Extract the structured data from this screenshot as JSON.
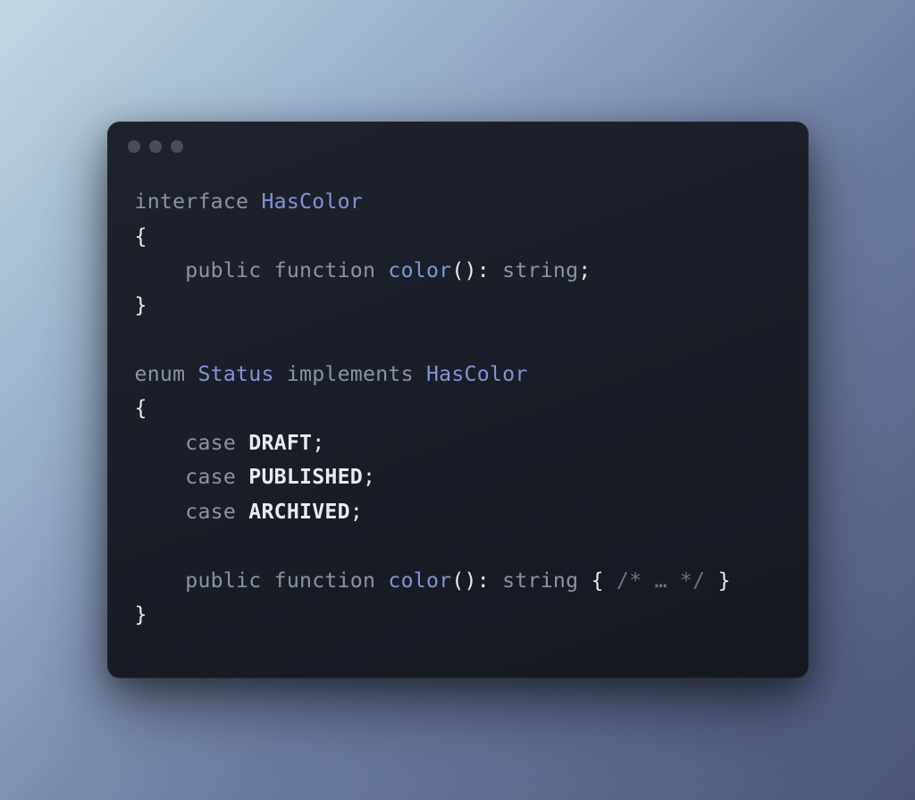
{
  "code": {
    "lines": [
      {
        "segments": [
          {
            "cls": "kw",
            "t": "interface"
          },
          {
            "cls": "",
            "t": " "
          },
          {
            "cls": "type",
            "t": "HasColor"
          }
        ]
      },
      {
        "segments": [
          {
            "cls": "brace",
            "t": "{"
          }
        ]
      },
      {
        "segments": [
          {
            "cls": "",
            "t": "    "
          },
          {
            "cls": "kw",
            "t": "public"
          },
          {
            "cls": "",
            "t": " "
          },
          {
            "cls": "kw",
            "t": "function"
          },
          {
            "cls": "",
            "t": " "
          },
          {
            "cls": "fn",
            "t": "color"
          },
          {
            "cls": "punct",
            "t": "():"
          },
          {
            "cls": "",
            "t": " "
          },
          {
            "cls": "retkw",
            "t": "string"
          },
          {
            "cls": "punct",
            "t": ";"
          }
        ]
      },
      {
        "segments": [
          {
            "cls": "brace",
            "t": "}"
          }
        ]
      },
      {
        "segments": [
          {
            "cls": "",
            "t": " "
          }
        ]
      },
      {
        "segments": [
          {
            "cls": "kw",
            "t": "enum"
          },
          {
            "cls": "",
            "t": " "
          },
          {
            "cls": "type",
            "t": "Status"
          },
          {
            "cls": "",
            "t": " "
          },
          {
            "cls": "kw",
            "t": "implements"
          },
          {
            "cls": "",
            "t": " "
          },
          {
            "cls": "type",
            "t": "HasColor"
          }
        ]
      },
      {
        "segments": [
          {
            "cls": "brace",
            "t": "{"
          }
        ]
      },
      {
        "segments": [
          {
            "cls": "",
            "t": "    "
          },
          {
            "cls": "kw",
            "t": "case"
          },
          {
            "cls": "",
            "t": " "
          },
          {
            "cls": "ident",
            "t": "DRAFT"
          },
          {
            "cls": "punct",
            "t": ";"
          }
        ]
      },
      {
        "segments": [
          {
            "cls": "",
            "t": "    "
          },
          {
            "cls": "kw",
            "t": "case"
          },
          {
            "cls": "",
            "t": " "
          },
          {
            "cls": "ident",
            "t": "PUBLISHED"
          },
          {
            "cls": "punct",
            "t": ";"
          }
        ]
      },
      {
        "segments": [
          {
            "cls": "",
            "t": "    "
          },
          {
            "cls": "kw",
            "t": "case"
          },
          {
            "cls": "",
            "t": " "
          },
          {
            "cls": "ident",
            "t": "ARCHIVED"
          },
          {
            "cls": "punct",
            "t": ";"
          }
        ]
      },
      {
        "segments": [
          {
            "cls": "",
            "t": " "
          }
        ]
      },
      {
        "segments": [
          {
            "cls": "",
            "t": "    "
          },
          {
            "cls": "kw",
            "t": "public"
          },
          {
            "cls": "",
            "t": " "
          },
          {
            "cls": "kw",
            "t": "function"
          },
          {
            "cls": "",
            "t": " "
          },
          {
            "cls": "fn",
            "t": "color"
          },
          {
            "cls": "punct",
            "t": "():"
          },
          {
            "cls": "",
            "t": " "
          },
          {
            "cls": "retkw",
            "t": "string"
          },
          {
            "cls": "",
            "t": " "
          },
          {
            "cls": "brace",
            "t": "{"
          },
          {
            "cls": "",
            "t": " "
          },
          {
            "cls": "comment",
            "t": "/* … */"
          },
          {
            "cls": "",
            "t": " "
          },
          {
            "cls": "brace",
            "t": "}"
          }
        ]
      },
      {
        "segments": [
          {
            "cls": "brace",
            "t": "}"
          }
        ]
      }
    ]
  }
}
